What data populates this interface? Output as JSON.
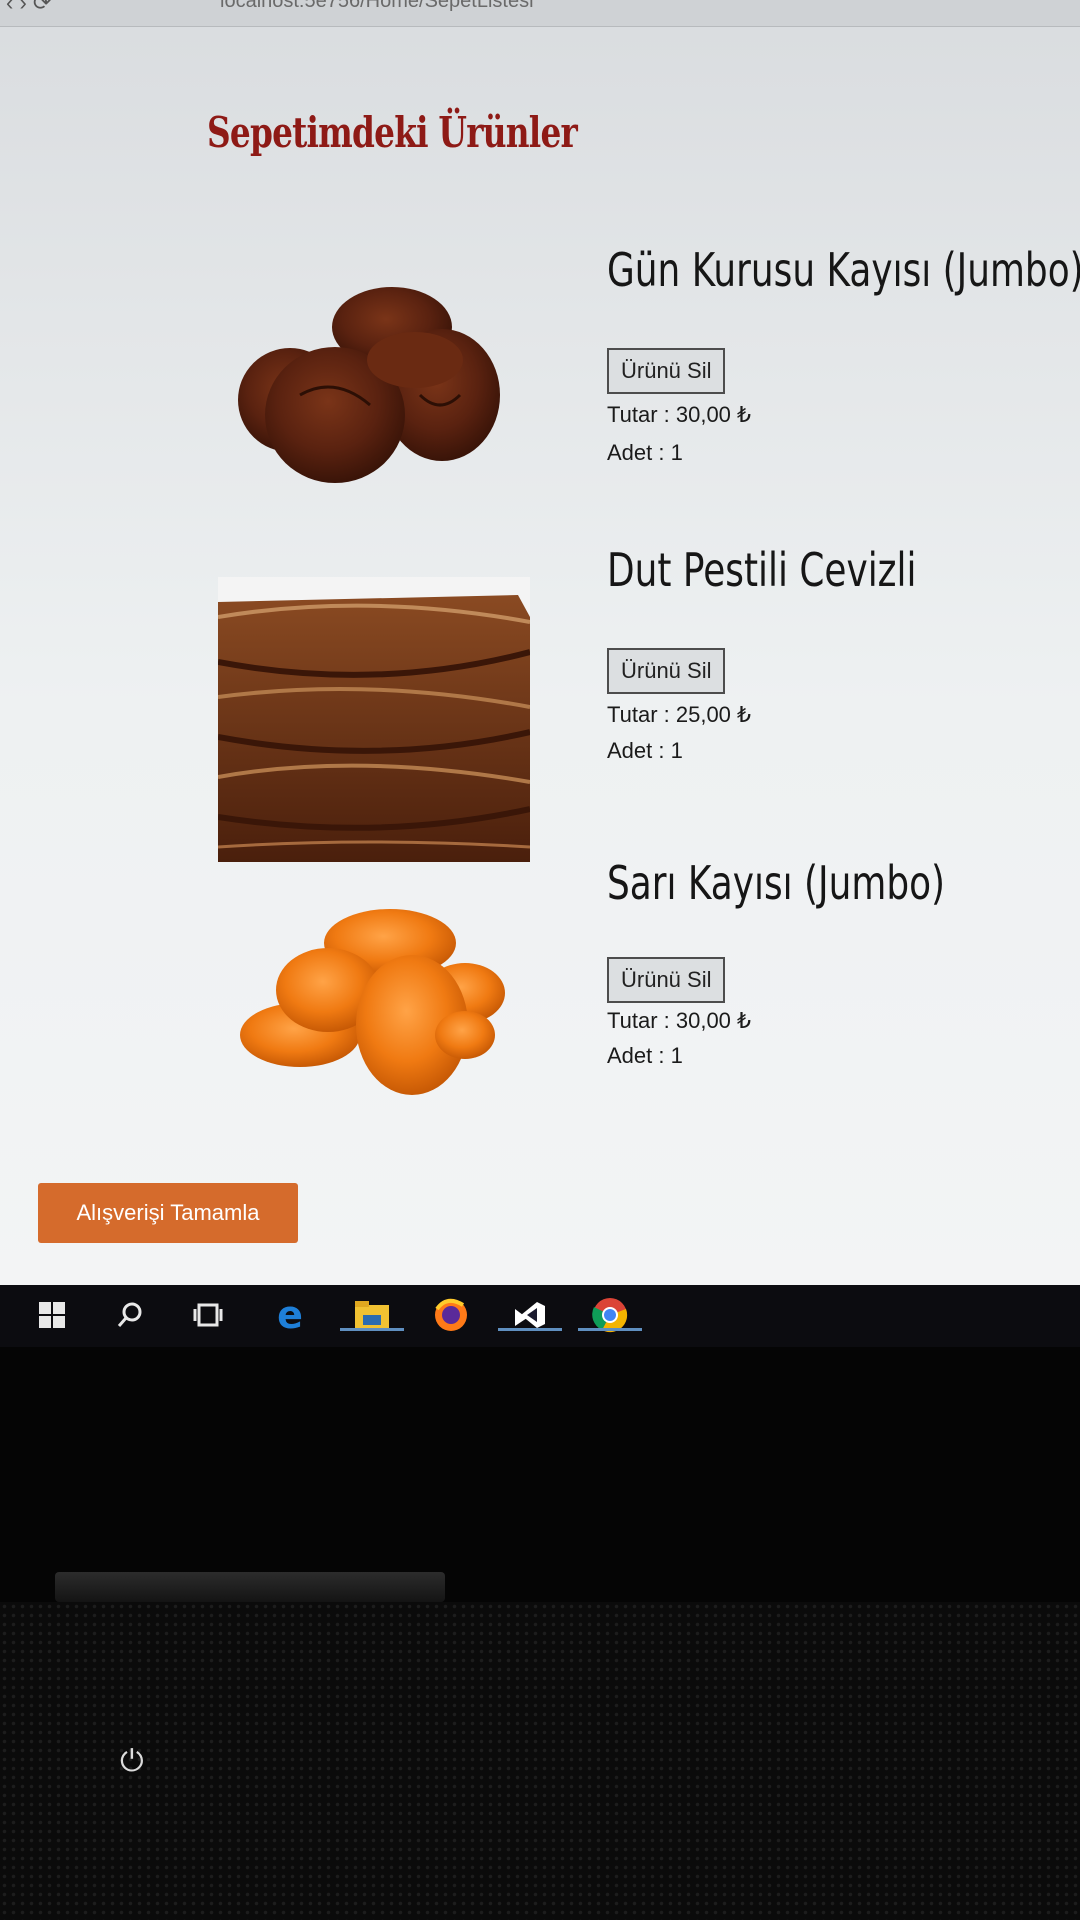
{
  "browser": {
    "url": "localhost:5e756/Home/SepetListesi"
  },
  "page": {
    "title": "Sepetimdeki Ürünler"
  },
  "items": [
    {
      "name": "Gün Kurusu Kayısı (Jumbo)",
      "delete_label": "Ürünü Sil",
      "amount": "Tutar : 30,00 ₺",
      "quantity": "Adet : 1"
    },
    {
      "name": "Dut Pestili Cevizli",
      "delete_label": "Ürünü Sil",
      "amount": "Tutar : 25,00 ₺",
      "quantity": "Adet : 1"
    },
    {
      "name": "Sarı Kayısı (Jumbo)",
      "delete_label": "Ürünü Sil",
      "amount": "Tutar : 30,00 ₺",
      "quantity": "Adet : 1"
    }
  ],
  "checkout": {
    "label": "Alışverişi Tamamla"
  },
  "taskbar": {
    "icons": [
      "windows-start-icon",
      "search-icon",
      "task-view-icon",
      "edge-icon",
      "file-explorer-icon",
      "firefox-icon",
      "visual-studio-icon",
      "chrome-icon"
    ]
  },
  "colors": {
    "title": "#8e1a16",
    "checkout_button": "#d56b2c"
  }
}
